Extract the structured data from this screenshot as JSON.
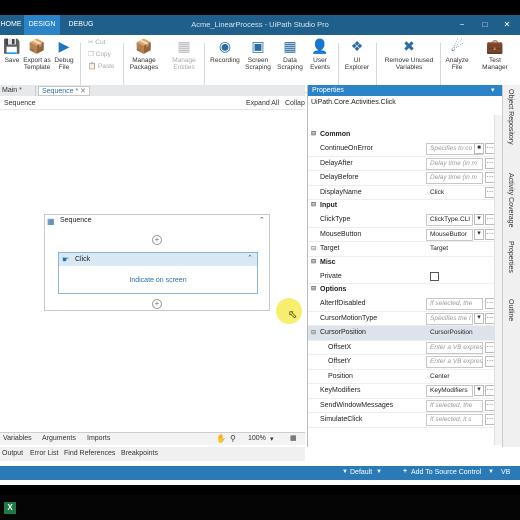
{
  "window": {
    "title": "Acme_LinearProcess - UiPath Studio Pro",
    "tabs": [
      "HOME",
      "DESIGN",
      "DEBUG"
    ],
    "controls": [
      "−",
      "□",
      "✕"
    ]
  },
  "ribbon": {
    "save": "Save",
    "export": "Export as Template",
    "debug": "Debug File",
    "cut": "Cut",
    "copy": "Copy",
    "paste": "Paste",
    "manage_packages": "Manage Packages",
    "manage_entities": "Manage Entities",
    "recording": "Recording",
    "screen_scraping": "Screen Scraping",
    "data_scraping": "Data Scraping",
    "user_events": "User Events",
    "ui_explorer": "UI Explorer",
    "remove_unused": "Remove Unused Variables",
    "analyze_file": "Analyze File",
    "test_manager": "Test Manager"
  },
  "document": {
    "tabs": [
      "Main *",
      "Sequence *"
    ],
    "breadcrumb": "Sequence",
    "expand_all": "Expand All",
    "collapse": "Collap"
  },
  "canvas": {
    "sequence_title": "Sequence",
    "activity_title": "Click",
    "indicate": "Indicate on screen",
    "add_symbol": "+"
  },
  "bottom": {
    "tabs": [
      "Variables",
      "Arguments",
      "Imports"
    ],
    "zoom": "100%",
    "output_tabs": [
      "Output",
      "Error List",
      "Find References",
      "Breakpoints"
    ]
  },
  "status": {
    "branch": "Default",
    "source_control": "Add To Source Control",
    "vb": "VB"
  },
  "properties": {
    "header": "Properties",
    "activity": "UiPath.Core.Activities.Click",
    "sections": [
      {
        "name": "Common",
        "rows": [
          {
            "name": "ContinueOnError",
            "value": "Specifies to co",
            "placeholder": true,
            "btn": "box"
          },
          {
            "name": "DelayAfter",
            "value": "Delay time (in m",
            "placeholder": true
          },
          {
            "name": "DelayBefore",
            "value": "Delay time (in m",
            "placeholder": true
          },
          {
            "name": "DisplayName",
            "value": "Click",
            "plain": true
          }
        ]
      },
      {
        "name": "Input",
        "rows": [
          {
            "name": "ClickType",
            "value": "ClickType.CLI",
            "dropdown": true
          },
          {
            "name": "MouseButton",
            "value": "MouseButtor",
            "dropdown": true
          },
          {
            "name": "Target",
            "value": "Target",
            "plain": true,
            "expander": true
          }
        ]
      },
      {
        "name": "Misc",
        "rows": [
          {
            "name": "Private",
            "value": "",
            "checkbox": true
          }
        ]
      },
      {
        "name": "Options",
        "rows": [
          {
            "name": "AlterIfDisabled",
            "value": "If selected, the",
            "placeholder": true
          },
          {
            "name": "CursorMotionType",
            "value": "Specifies the t",
            "placeholder": true,
            "dropdown": true
          },
          {
            "name": "CursorPosition",
            "value": "CursorPosition",
            "plain": true,
            "expander": true,
            "highlight": true
          },
          {
            "name": "OffsetX",
            "value": "Enter a VB expres",
            "placeholder": true,
            "indent": true
          },
          {
            "name": "OffsetY",
            "value": "Enter a VB expres",
            "placeholder": true,
            "indent": true
          },
          {
            "name": "Position",
            "value": "Center",
            "plain": true,
            "indent": true
          },
          {
            "name": "KeyModifiers",
            "value": "KeyModifiers",
            "dropdown": true
          },
          {
            "name": "SendWindowMessages",
            "value": "If selected, the",
            "placeholder": true
          },
          {
            "name": "SimulateClick",
            "value": "If selected, it s",
            "placeholder": true
          }
        ]
      }
    ]
  },
  "side_tabs": [
    "Object Repository",
    "Activity Coverage",
    "Properties",
    "Outline"
  ],
  "taskbar": {
    "excel_icon": "X"
  }
}
